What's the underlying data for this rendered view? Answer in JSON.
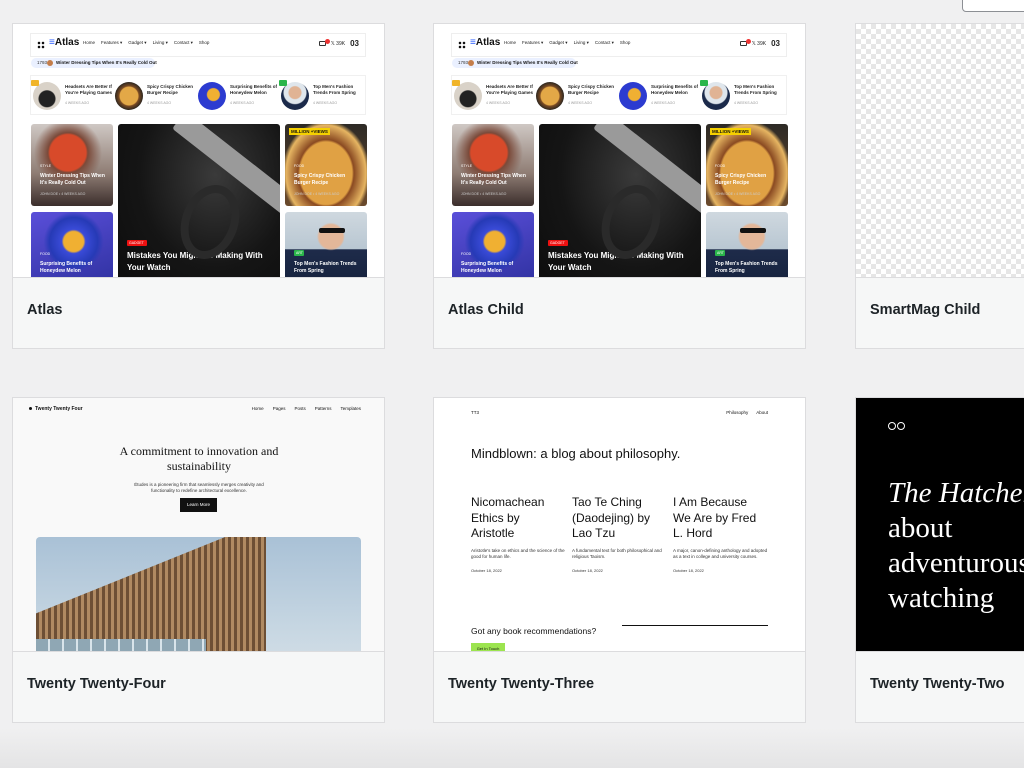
{
  "themes": [
    {
      "name": "Atlas"
    },
    {
      "name": "Atlas Child"
    },
    {
      "name": "SmartMag Child"
    },
    {
      "name": "Twenty Twenty-Four"
    },
    {
      "name": "Twenty Twenty-Three"
    },
    {
      "name": "Twenty Twenty-Two"
    }
  ],
  "atlas_preview": {
    "logo": "Atlas",
    "menu": [
      "Home",
      "Features ▾",
      "Gadget ▾",
      "Living ▾",
      "Contact ▾",
      "Shop"
    ],
    "social": "𝕏 39K",
    "date_day": "03",
    "trending_tag": "1793",
    "trending_text": "Winter Dressing Tips When It's Really Cold Out",
    "strip": [
      {
        "title": "Headsets Are Better If You're Playing Games",
        "meta": "4 WEEKS AGO"
      },
      {
        "title": "Spicy Crispy Chicken Burger Recipe",
        "meta": "4 WEEKS AGO"
      },
      {
        "title": "Surprising Benefits of Honeydew Melon",
        "meta": "4 WEEKS AGO"
      },
      {
        "title": "Top Men's Fashion Trends From Spring",
        "meta": "4 WEEKS AGO"
      }
    ],
    "tiles": {
      "t1": {
        "tag": "STYLE",
        "title": "Winter Dressing Tips When It's Really Cold Out",
        "meta": "JOHN DOE • 4 WEEKS AGO"
      },
      "t2": {
        "tag": "FOOD",
        "title": "Surprising Benefits of Honeydew Melon",
        "meta": "JOHN DOE • 4 WEEKS AGO"
      },
      "t3": {
        "tag": "GADGET",
        "title": "Mistakes You Might Be Making With Your Watch",
        "meta": "JOHN DOE • 4 WEEKS AGO"
      },
      "t4": {
        "tag": "FOOD",
        "title": "Spicy Crispy Chicken Burger Recipe",
        "meta": "JOHN DOE • 4 WEEKS AGO",
        "badge": "MILLION +VIEWS"
      },
      "t5": {
        "tag": "ART",
        "title": "Top Men's Fashion Trends From Spring",
        "meta": "JOHN DOE • 4 WEEKS AGO"
      }
    }
  },
  "t24_preview": {
    "brand": "Twenty Twenty Four",
    "nav": [
      "Home",
      "Pages",
      "Posts",
      "Patterns",
      "Templates"
    ],
    "headline": "A commitment to innovation and sustainability",
    "text": "Études is a pioneering firm that seamlessly merges creativity and functionality to redefine architectural excellence.",
    "button": "Learn More"
  },
  "t23_preview": {
    "brand": "TT3",
    "nav": [
      "Philosophy",
      "About"
    ],
    "headline": "Mindblown: a blog about philosophy.",
    "posts": [
      {
        "title": "Nicomachean Ethics by Aristotle",
        "excerpt": "Aristotle's take on ethics and the science of the good for human life.",
        "date": "October 18, 2022"
      },
      {
        "title": "Tao Te Ching (Daodejing) by Lao Tzu",
        "excerpt": "A fundamental text for both philosophical and religious Taoism.",
        "date": "October 18, 2022"
      },
      {
        "title": "I Am Because We Are by Fred L. Hord",
        "excerpt": "A major, canon-defining anthology and adopted as a text in college and university courses.",
        "date": "October 18, 2022"
      }
    ],
    "question": "Got any book recommendations?",
    "button": "Get In Touch"
  },
  "t22_preview": {
    "headline_italic": "The Hatchery:",
    "headline_rest": "about adventurous bird watching"
  },
  "colors": {
    "background": "#f0f0f1",
    "card_footer": "#f6f7f7",
    "card_border": "#dcdcde",
    "atlas_accent": "#2b5cff",
    "t23_button": "#9ce44f"
  }
}
